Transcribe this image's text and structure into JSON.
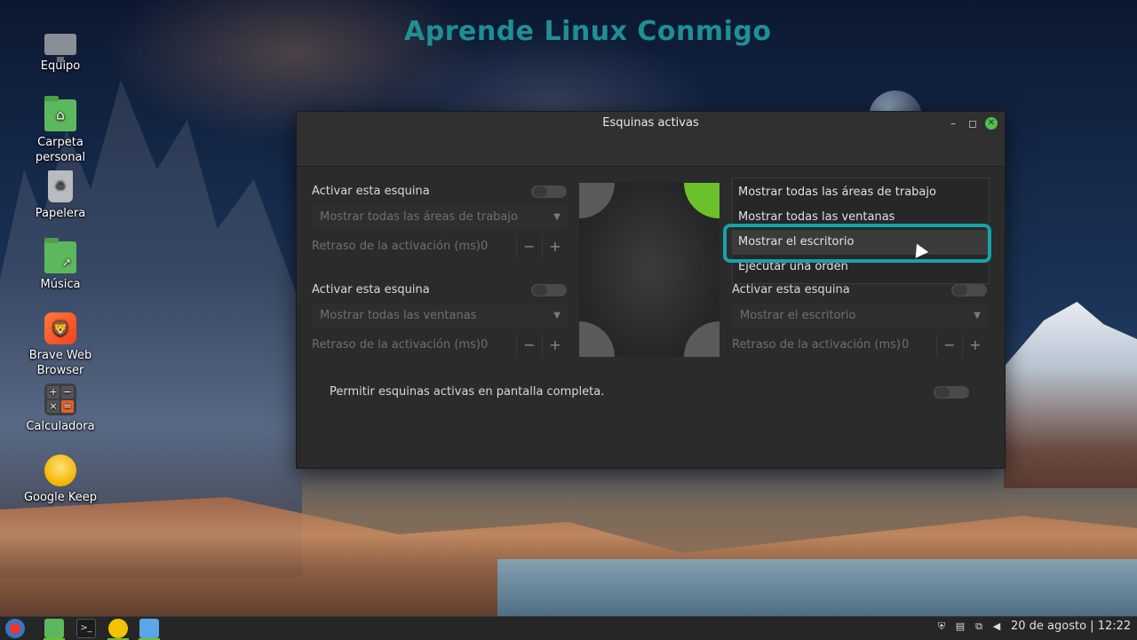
{
  "watermark": "Aprende Linux Conmigo",
  "desktop": {
    "icons": [
      {
        "label": "Equipo",
        "icon": "computer-icon"
      },
      {
        "label": "Carpeta personal",
        "icon": "home-folder-icon"
      },
      {
        "label": "Papelera",
        "icon": "trash-icon"
      },
      {
        "label": "Música",
        "icon": "music-folder-icon"
      },
      {
        "label": "Brave Web Browser",
        "icon": "brave-icon"
      },
      {
        "label": "Calculadora",
        "icon": "calculator-icon"
      },
      {
        "label": "Google Keep",
        "icon": "keep-bulb-icon"
      }
    ]
  },
  "window": {
    "title": "Esquinas activas",
    "controls": {
      "minimize": "–",
      "maximize": "◻",
      "close": "✕"
    },
    "top_left": {
      "enable_label": "Activar esta esquina",
      "action": "Mostrar todas las áreas de trabajo",
      "delay_label": "Retraso de la activación (ms)",
      "delay_value": "0"
    },
    "bottom_left": {
      "enable_label": "Activar esta esquina",
      "action": "Mostrar todas las ventanas",
      "delay_label": "Retraso de la activación (ms)",
      "delay_value": "0"
    },
    "bottom_right": {
      "enable_label": "Activar esta esquina",
      "action": "Mostrar el escritorio",
      "delay_label": "Retraso de la activación (ms)",
      "delay_value": "0"
    },
    "top_right_dropdown": {
      "options": [
        "Mostrar todas las áreas de trabajo",
        "Mostrar todas las ventanas",
        "Mostrar el escritorio",
        "Ejecutar una orden"
      ],
      "selected": "Mostrar el escritorio"
    },
    "fullscreen_label": "Permitir esquinas activas en pantalla completa.",
    "spin_minus": "−",
    "spin_plus": "+"
  },
  "colors": {
    "active_corner": "#6cc02a",
    "highlight": "#15a3a6",
    "watermark": "#1f8f94"
  },
  "taskbar": {
    "clock": "20 de agosto | 12:22",
    "terminal_glyph": ">_"
  }
}
